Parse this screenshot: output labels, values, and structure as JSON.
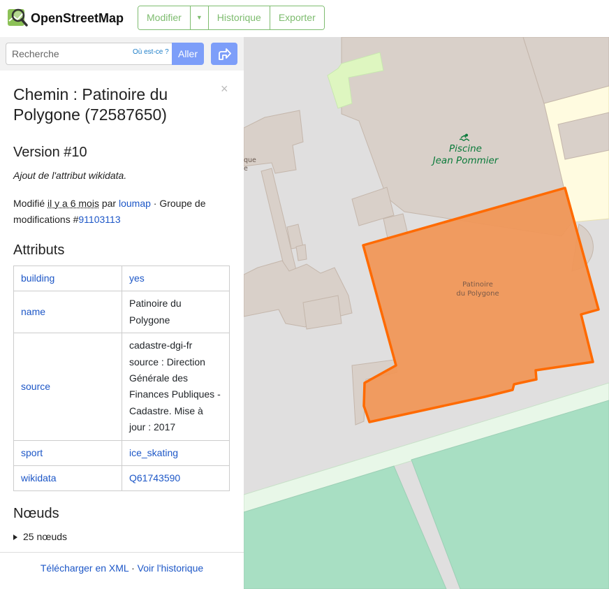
{
  "header": {
    "brand": "OpenStreetMap",
    "buttons": {
      "edit": "Modifier",
      "history": "Historique",
      "export": "Exporter"
    }
  },
  "search": {
    "placeholder": "Recherche",
    "where_is": "Où est-ce ?",
    "go": "Aller"
  },
  "panel": {
    "title": "Chemin : Patinoire du Polygone (72587650)",
    "close": "×",
    "version": "Version #10",
    "comment": "Ajout de l'attribut wikidata.",
    "modified_prefix": "Modifié",
    "modified_time": "il y a 6 mois",
    "modified_by": "par",
    "user": "loumap",
    "changeset_label": "· Groupe de modifications #",
    "changeset": "91103113",
    "attributes_title": "Attributs",
    "attributes": [
      {
        "key": "building",
        "value": "yes",
        "link": true
      },
      {
        "key": "name",
        "value": "Patinoire du Polygone",
        "link": false
      },
      {
        "key": "source",
        "value": "cadastre-dgi-fr source : Direction Générale des Finances Publiques - Cadastre. Mise à jour : 2017",
        "link": false
      },
      {
        "key": "sport",
        "value": "ice_skating",
        "link": true
      },
      {
        "key": "wikidata",
        "value": "Q61743590",
        "link": true
      }
    ],
    "nodes_title": "Nœuds",
    "nodes_count": "25 nœuds"
  },
  "footer": {
    "xml": "Télécharger en XML",
    "sep": "·",
    "history": "Voir l'historique"
  },
  "map": {
    "pool_label_1": "Piscine",
    "pool_label_2": "Jean Pommier",
    "rink_label_1": "Patinoire",
    "rink_label_2": "du Polygone",
    "cut_label_1": "que",
    "cut_label_2": "e"
  },
  "colors": {
    "accent_green": "#7ebc6f",
    "button_blue": "#7d9ef9",
    "link_blue": "#1d57c7",
    "highlight_orange": "#ff6a00",
    "building_fill": "#d9d0c9",
    "grass": "#a8dfc3"
  }
}
